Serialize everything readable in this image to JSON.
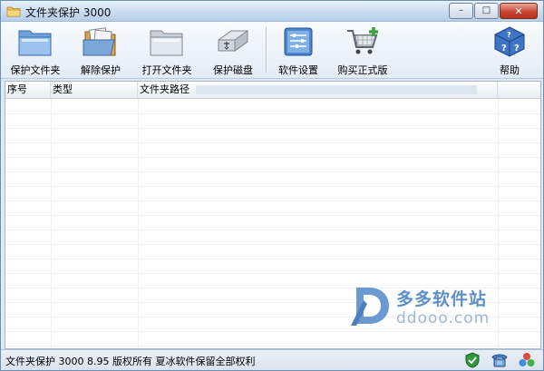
{
  "window": {
    "title": "文件夹保护 3000",
    "controls": {
      "minimize": "–",
      "maximize": "□",
      "close": "✕"
    }
  },
  "toolbar": {
    "items": [
      {
        "label": "保护文件夹",
        "icon": "blue-folder-icon"
      },
      {
        "label": "解除保护",
        "icon": "open-folder-documents-icon"
      },
      {
        "label": "打开文件夹",
        "icon": "gray-folder-icon"
      },
      {
        "label": "保护磁盘",
        "icon": "usb-disk-icon"
      },
      {
        "label": "软件设置",
        "icon": "settings-panel-icon"
      },
      {
        "label": "购买正式版",
        "icon": "shopping-cart-icon"
      },
      {
        "label": "帮助",
        "icon": "help-cube-icon"
      }
    ]
  },
  "table": {
    "columns": [
      "序号",
      "类型",
      "文件夹路径"
    ],
    "rows": []
  },
  "watermark": {
    "cn": "多多软件站",
    "en": "ddooo.com"
  },
  "statusbar": {
    "text": "文件夹保护 3000 8.95 版权所有 夏冰软件保留全部权利",
    "icons": [
      "shield-check-icon",
      "phone-icon",
      "colors-icon"
    ]
  },
  "colors": {
    "accent": "#3f74b8",
    "title_bg": "#c9dcf0",
    "close_red": "#c8412c"
  }
}
